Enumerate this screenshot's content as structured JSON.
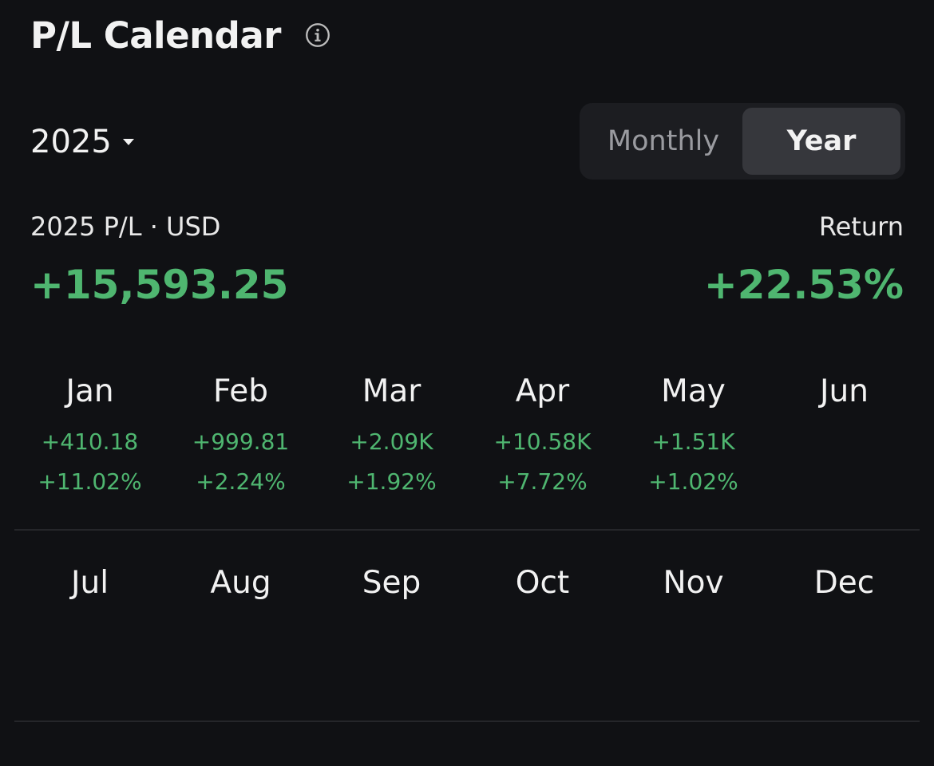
{
  "header": {
    "title": "P/L Calendar",
    "info_icon": "info-icon"
  },
  "year_selector": {
    "value": "2025",
    "icon": "caret-down-icon"
  },
  "view_toggle": {
    "options": [
      "Monthly",
      "Year"
    ],
    "selected": "Year"
  },
  "summary": {
    "pl_label": "2025 P/L · USD",
    "pl_value": "+15,593.25",
    "return_label": "Return",
    "return_value": "+22.53%"
  },
  "colors": {
    "background": "#101114",
    "positive": "#4fb670",
    "toggle_bg": "#1c1d21",
    "toggle_active": "#36373c"
  },
  "months": [
    {
      "name": "Jan",
      "pl": "+410.18",
      "ret": "+11.02%"
    },
    {
      "name": "Feb",
      "pl": "+999.81",
      "ret": "+2.24%"
    },
    {
      "name": "Mar",
      "pl": "+2.09K",
      "ret": "+1.92%"
    },
    {
      "name": "Apr",
      "pl": "+10.58K",
      "ret": "+7.72%"
    },
    {
      "name": "May",
      "pl": "+1.51K",
      "ret": "+1.02%"
    },
    {
      "name": "Jun",
      "pl": "",
      "ret": ""
    },
    {
      "name": "Jul",
      "pl": "",
      "ret": ""
    },
    {
      "name": "Aug",
      "pl": "",
      "ret": ""
    },
    {
      "name": "Sep",
      "pl": "",
      "ret": ""
    },
    {
      "name": "Oct",
      "pl": "",
      "ret": ""
    },
    {
      "name": "Nov",
      "pl": "",
      "ret": ""
    },
    {
      "name": "Dec",
      "pl": "",
      "ret": ""
    }
  ]
}
